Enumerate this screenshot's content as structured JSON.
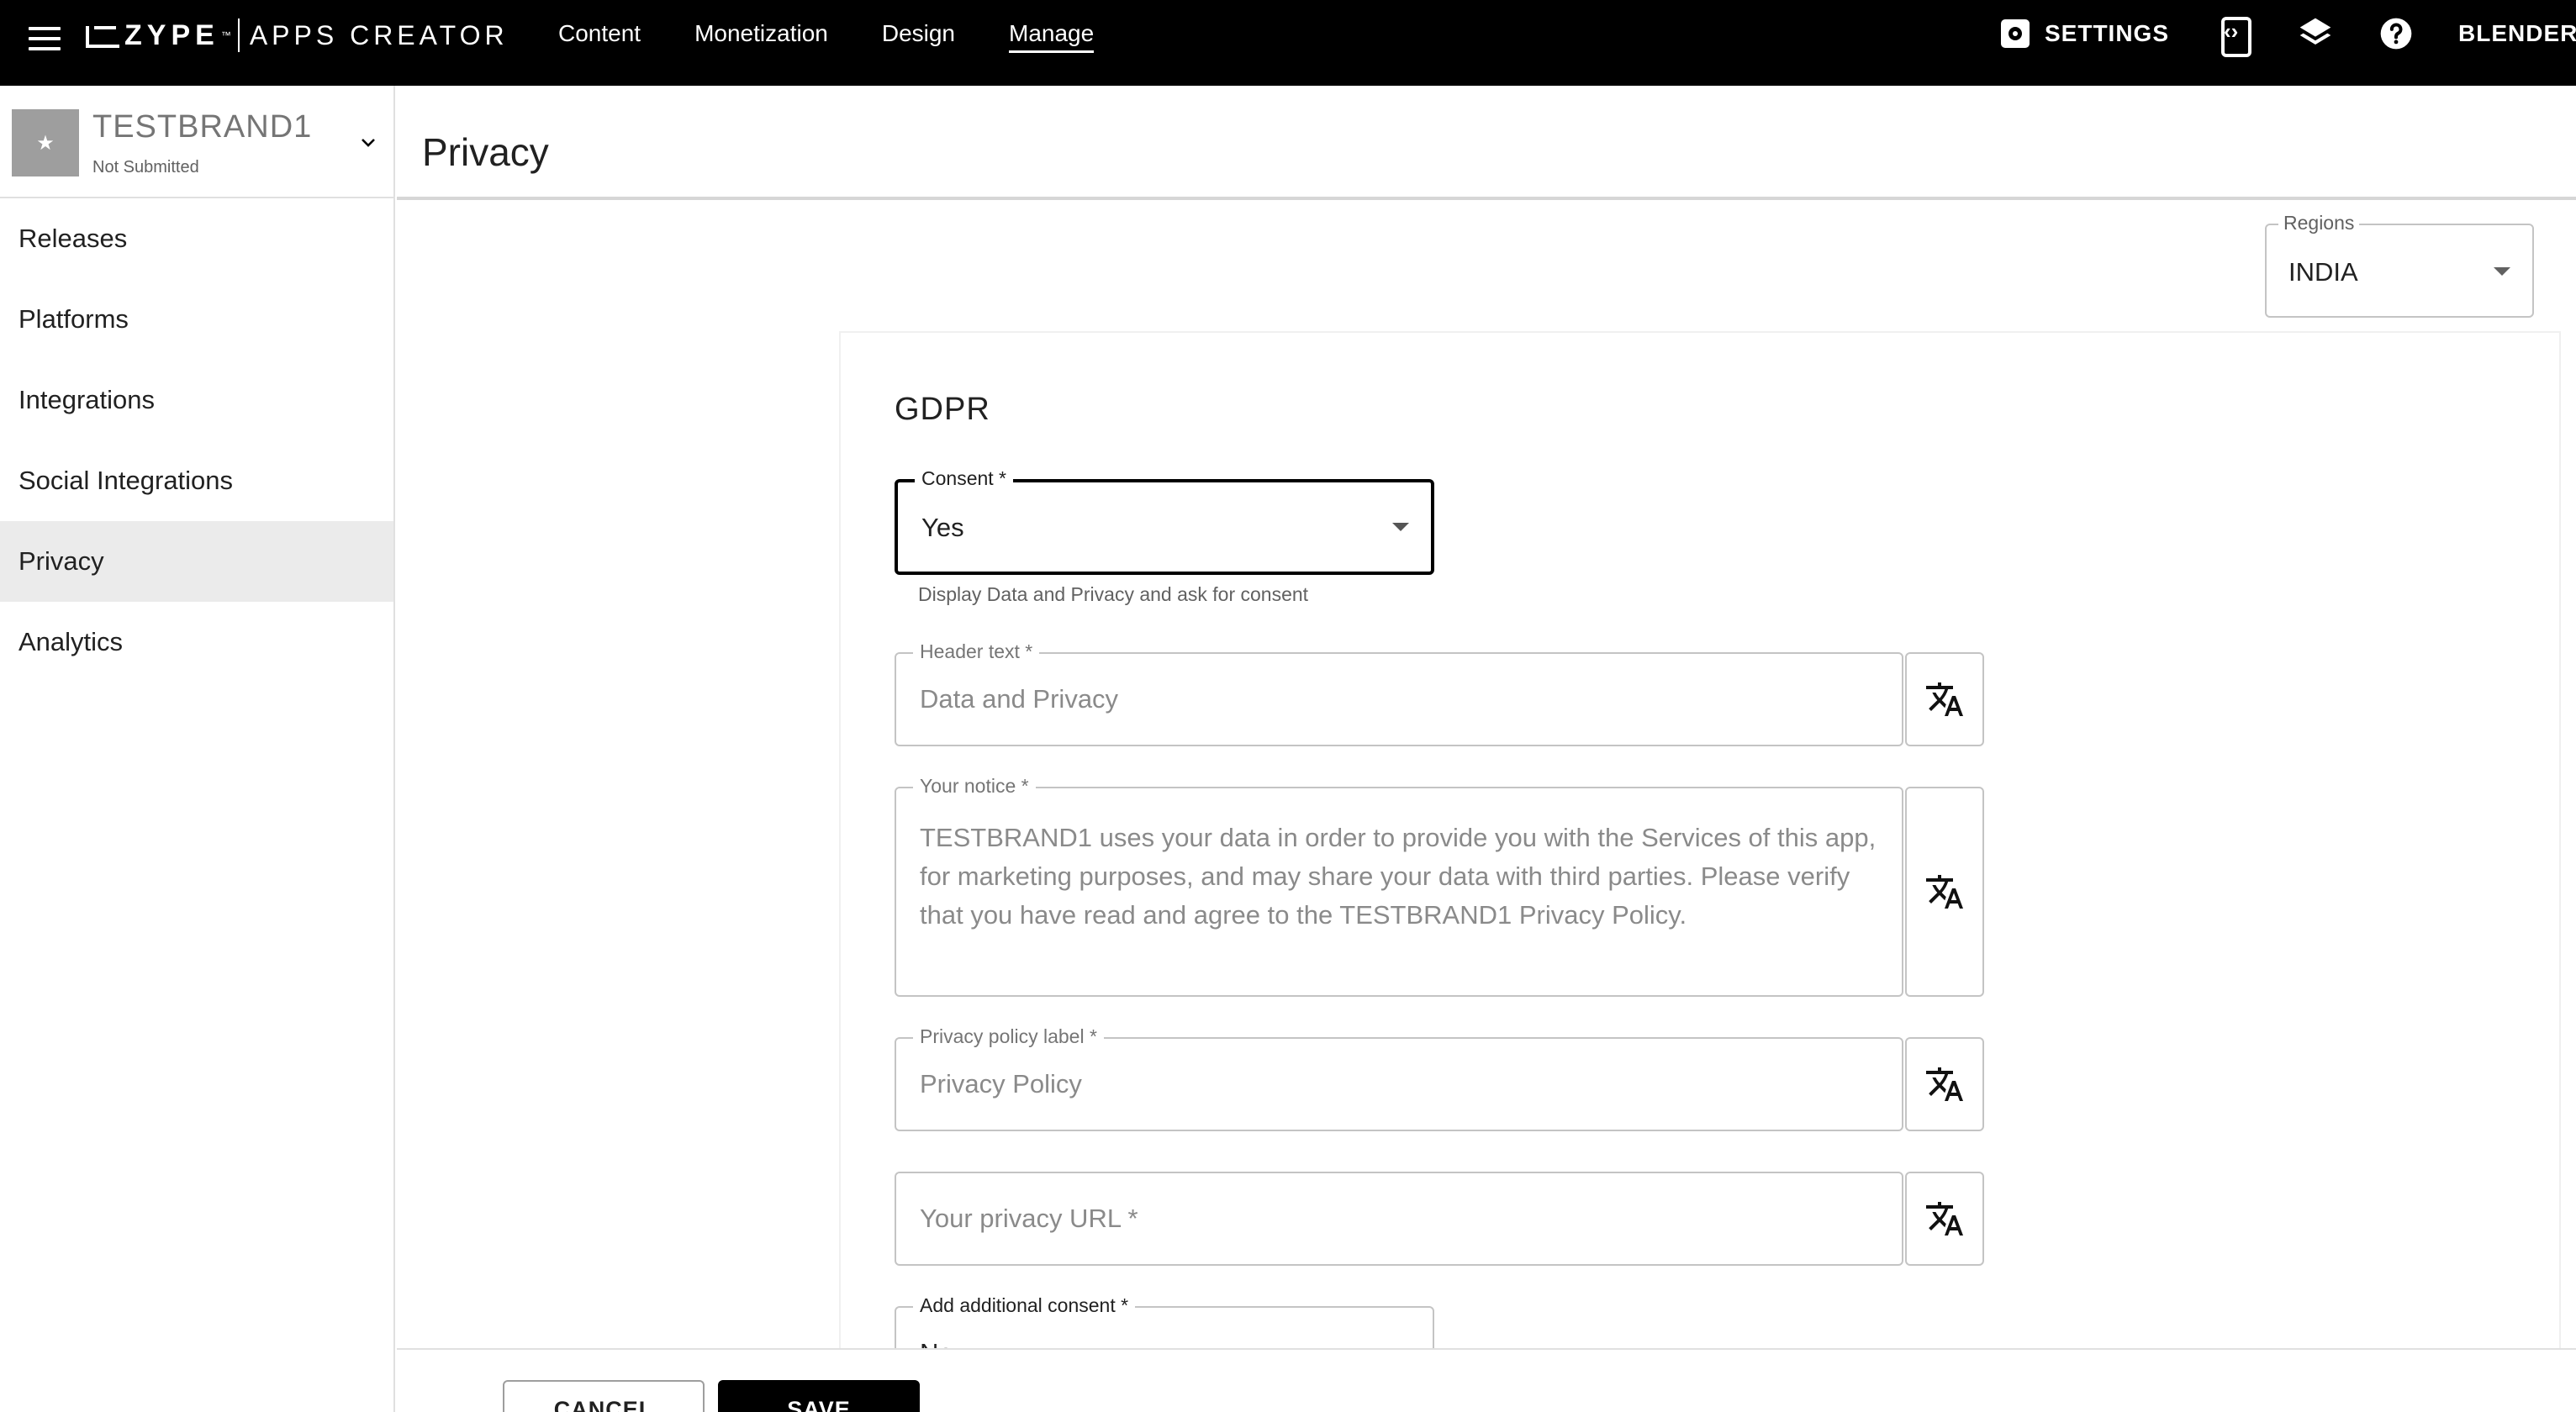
{
  "topbar": {
    "logo_brand": "ZYPE",
    "logo_tm": "™",
    "logo_app": "APPS CREATOR",
    "nav": [
      "Content",
      "Monetization",
      "Design",
      "Manage"
    ],
    "active_nav": "Manage",
    "settings_label": "SETTINGS",
    "user": "BLENDER D"
  },
  "sidebar": {
    "brand_name": "TESTBRAND1",
    "brand_status": "Not Submitted",
    "thumb_glyph": "★",
    "items": [
      {
        "label": "Releases"
      },
      {
        "label": "Platforms"
      },
      {
        "label": "Integrations"
      },
      {
        "label": "Social Integrations"
      },
      {
        "label": "Privacy",
        "active": true
      },
      {
        "label": "Analytics"
      }
    ]
  },
  "page": {
    "title": "Privacy",
    "regions": {
      "label": "Regions",
      "value": "INDIA"
    }
  },
  "gdpr": {
    "heading": "GDPR",
    "consent": {
      "label": "Consent *",
      "value": "Yes",
      "helper": "Display Data and Privacy and ask for consent"
    },
    "header_text": {
      "label": "Header text *",
      "value": "Data and Privacy"
    },
    "notice": {
      "label": "Your notice *",
      "value": "TESTBRAND1 uses your data in order to provide you with the Services of this app, for marketing purposes, and may share your data with third parties. Please verify that you have read and agree to the TESTBRAND1 Privacy Policy."
    },
    "policy_label": {
      "label": "Privacy policy label *",
      "value": "Privacy Policy"
    },
    "privacy_url": {
      "placeholder": "Your privacy URL *"
    },
    "additional_consent": {
      "label": "Add additional consent *",
      "value": "No"
    }
  },
  "footer": {
    "cancel": "CANCEL",
    "save": "SAVE"
  }
}
